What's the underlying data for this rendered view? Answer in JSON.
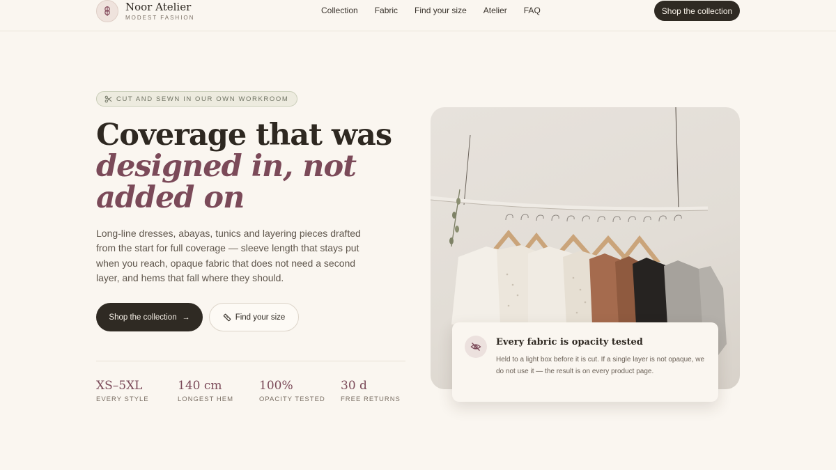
{
  "brand": {
    "name": "Noor Atelier",
    "tagline": "MODEST FASHION",
    "logo_icon": "flower-icon"
  },
  "nav": {
    "items": [
      {
        "label": "Collection"
      },
      {
        "label": "Fabric"
      },
      {
        "label": "Find your size"
      },
      {
        "label": "Atelier"
      },
      {
        "label": "FAQ"
      }
    ],
    "cta_label": "Shop the collection"
  },
  "hero": {
    "eyebrow": "CUT AND SEWN IN OUR OWN WORKROOM",
    "eyebrow_icon": "scissors-icon",
    "headline_line1": "Coverage that was",
    "headline_accent": "designed in, not added on",
    "lede": "Long-line dresses, abayas, tunics and layering pieces drafted from the start for full coverage — sleeve length that stays put when you reach, opaque fabric that does not need a second layer, and hems that fall where they should.",
    "primary_button": "Shop the collection",
    "primary_button_icon": "arrow-right-icon",
    "secondary_button": "Find your size",
    "secondary_button_icon": "ruler-icon"
  },
  "stats": [
    {
      "value": "XS–5XL",
      "label": "EVERY STYLE"
    },
    {
      "value": "140 cm",
      "label": "LONGEST HEM"
    },
    {
      "value": "100%",
      "label": "OPACITY TESTED"
    },
    {
      "value": "30 d",
      "label": "FREE RETURNS"
    }
  ],
  "card": {
    "icon": "eye-off-icon",
    "title": "Every fabric is opacity tested",
    "body": "Held to a light box before it is cut. If a single layer is not opaque, we do not use it — the result is on every product page."
  },
  "colors": {
    "background": "#faf6f0",
    "dark": "#2f2a23",
    "accent": "#7b4a59",
    "muted_text": "#5e554b"
  }
}
